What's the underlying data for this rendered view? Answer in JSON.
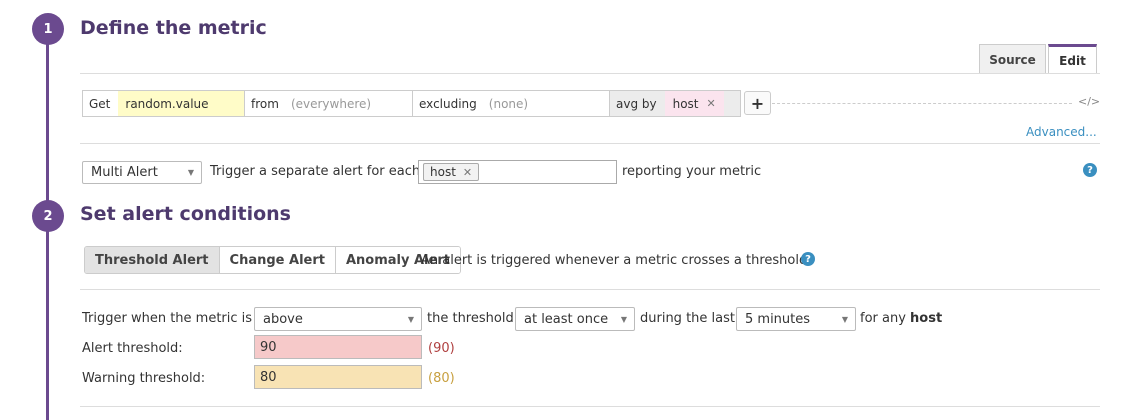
{
  "steps": [
    {
      "number": "1",
      "title": "Define the metric"
    },
    {
      "number": "2",
      "title": "Set alert conditions"
    }
  ],
  "tabs": {
    "source": "Source",
    "edit": "Edit"
  },
  "query": {
    "get_label": "Get",
    "metric": "random.value",
    "from_label": "from",
    "from_value": "(everywhere)",
    "excluding_label": "excluding",
    "excluding_value": "(none)",
    "avg_label": "avg by",
    "avg_tag": "host",
    "add_label": "+",
    "code_icon": "</>",
    "advanced": "Advanced..."
  },
  "multi_alert": {
    "select": "Multi Alert",
    "text_before": "Trigger a separate alert for each",
    "tag": "host",
    "text_after": "reporting your metric",
    "help": "?"
  },
  "alert_types": {
    "buttons": [
      "Threshold Alert",
      "Change Alert",
      "Anomaly Alert"
    ],
    "description": "An alert is triggered whenever a metric crosses a threshold.",
    "help": "?"
  },
  "trigger": {
    "label": "Trigger when the metric is",
    "condition": "above",
    "threshold_label": "the threshold",
    "frequency": "at least once",
    "during_label": "during the last",
    "window": "5 minutes",
    "for_any": "for any",
    "group": "host"
  },
  "thresholds": {
    "alert_label": "Alert threshold:",
    "alert_value": "90",
    "alert_preview": "(90)",
    "warning_label": "Warning threshold:",
    "warning_value": "80",
    "warning_preview": "(80)"
  },
  "colors": {
    "accent": "#6b4a8f",
    "link": "#3a8fc0",
    "metric_highlight": "#fffcc8",
    "tag_highlight": "#fbe4ee",
    "alert_fill": "#f6c9c9",
    "warning_fill": "#f8e3b4"
  }
}
